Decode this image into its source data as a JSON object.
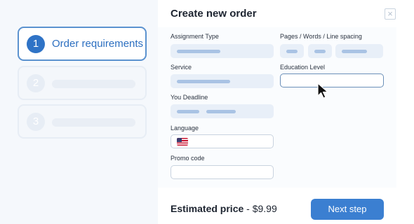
{
  "modal": {
    "title": "Create new order",
    "close_icon": "close-icon"
  },
  "steps": [
    {
      "number": "1",
      "label": "Order requirements",
      "active": true
    },
    {
      "number": "2",
      "label": "",
      "active": false
    },
    {
      "number": "3",
      "label": "",
      "active": false
    }
  ],
  "form": {
    "assignment_type_label": "Assignment Type",
    "service_label": "Service",
    "deadline_label": "You Deadline",
    "language_label": "Language",
    "language_flag_icon": "us-flag-icon",
    "promo_code_label": "Promo code",
    "pages_label": "Pages / Words / Line spacing",
    "education_level_label": "Education Level"
  },
  "footer": {
    "estimate_label": "Estimated price",
    "estimate_separator": " - ",
    "estimate_value": "$9.99",
    "next_button": "Next step"
  },
  "colors": {
    "accent": "#3b7fd1",
    "active_step_border": "#5b92cf",
    "placeholder_fill": "#e8eff8"
  }
}
